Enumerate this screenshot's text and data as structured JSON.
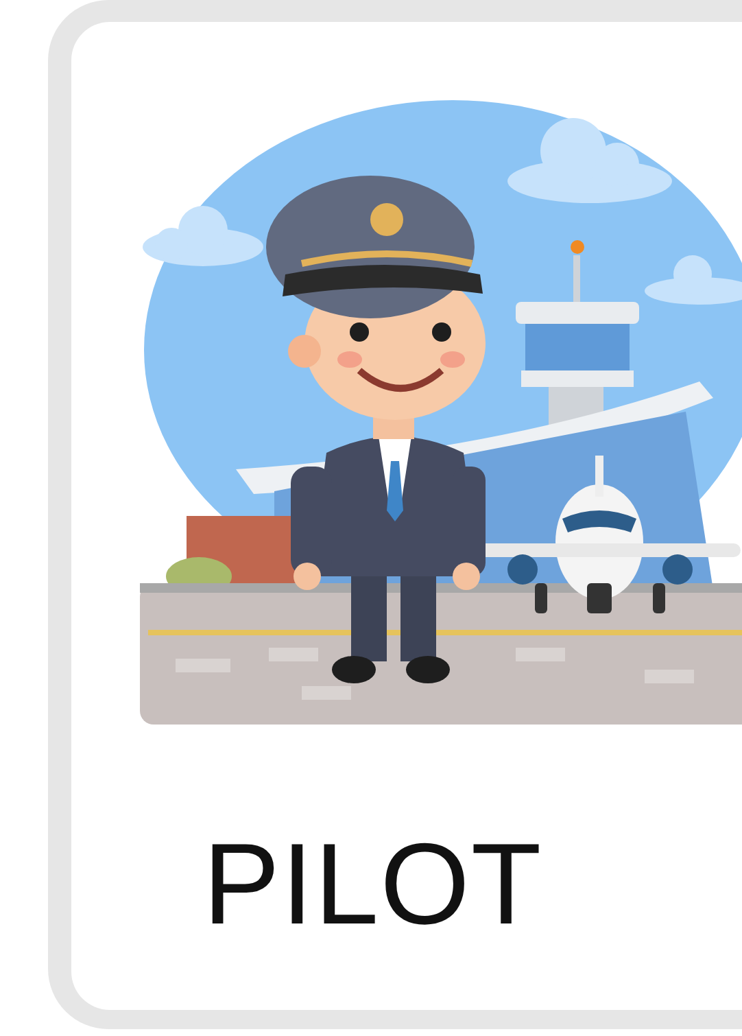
{
  "card": {
    "word": "PILOT"
  }
}
